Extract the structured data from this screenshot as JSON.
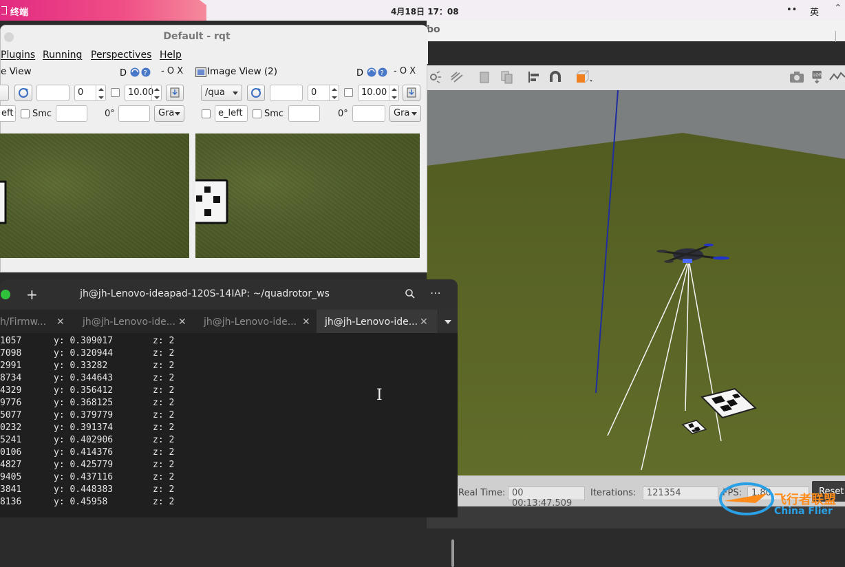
{
  "topbar": {
    "app_name": "终端",
    "clock": "4月18日  17：08",
    "tray_a": "••",
    "tray_b": "英",
    "tray_c": "⌃"
  },
  "gazebo": {
    "title_fragment": "bo",
    "status": {
      "real_time_label": "Real Time:",
      "real_time": "00 00:13:47.509",
      "iterations_label": "Iterations:",
      "iterations": "121354",
      "fps_label": "FPS:",
      "fps": "1.80",
      "reset": "Reset"
    }
  },
  "rqt": {
    "title": "Default - rqt",
    "menu": [
      "Plugins",
      "Running",
      "Perspectives",
      "Help"
    ],
    "left_dock": {
      "title": "e View",
      "ctrl": "-  O  X",
      "num_a": "0",
      "num_b": "10.00",
      "topic_frag": "eft",
      "smooth_label": "Smc",
      "deg": "0°",
      "combo_gray": "Gra"
    },
    "right_dock": {
      "title": "Image View (2)",
      "ctrl": "-  O  X",
      "topic": "/qua",
      "num_a": "0",
      "num_b": "10.00",
      "topic_suffix": "e_left",
      "smooth_label": "Smc",
      "deg": "0°",
      "combo_gray": "Gra"
    }
  },
  "terminal": {
    "title": "jh@jh-Lenovo-ideapad-120S-14IAP: ~/quadrotor_ws",
    "tabs": [
      {
        "label": "h/Firmw..."
      },
      {
        "label": "jh@jh-Lenovo-ide..."
      },
      {
        "label": "jh@jh-Lenovo-ide..."
      },
      {
        "label": "jh@jh-Lenovo-ide..."
      }
    ],
    "lines": [
      {
        "x": "1057",
        "y": "y: 0.309017",
        "z": "z: 2"
      },
      {
        "x": "7098",
        "y": "y: 0.320944",
        "z": "z: 2"
      },
      {
        "x": "2991",
        "y": "y: 0.33282",
        "z": "z: 2"
      },
      {
        "x": "8734",
        "y": "y: 0.344643",
        "z": "z: 2"
      },
      {
        "x": "4329",
        "y": "y: 0.356412",
        "z": "z: 2"
      },
      {
        "x": "9776",
        "y": "y: 0.368125",
        "z": "z: 2"
      },
      {
        "x": "5077",
        "y": "y: 0.379779",
        "z": "z: 2"
      },
      {
        "x": "0232",
        "y": "y: 0.391374",
        "z": "z: 2"
      },
      {
        "x": "5241",
        "y": "y: 0.402906",
        "z": "z: 2"
      },
      {
        "x": "0106",
        "y": "y: 0.414376",
        "z": "z: 2"
      },
      {
        "x": "4827",
        "y": "y: 0.425779",
        "z": "z: 2"
      },
      {
        "x": "9405",
        "y": "y: 0.437116",
        "z": "z: 2"
      },
      {
        "x": "3841",
        "y": "y: 0.448383",
        "z": "z: 2"
      },
      {
        "x": "8136",
        "y": "y: 0.45958",
        "z": "z: 2"
      }
    ]
  },
  "watermark": {
    "cn": "飞行者联盟",
    "en": "China Flier"
  },
  "colors": {
    "topbar_accent": "#e22a82",
    "terminal_bg": "#1f1f1f",
    "grass": "#5a6626",
    "gazebo_bg": "#7c7f7f"
  }
}
